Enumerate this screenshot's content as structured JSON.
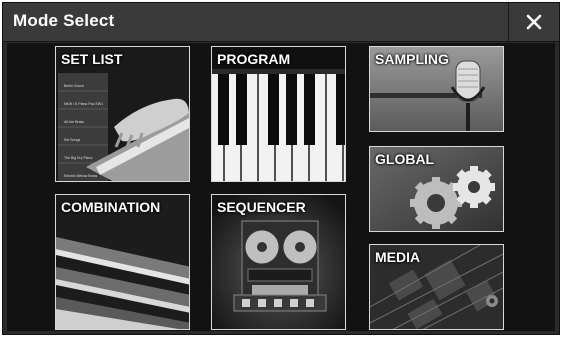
{
  "header": {
    "title": "Mode Select",
    "close_icon": "close-icon"
  },
  "tiles": {
    "set_list": {
      "label": "SET LIST",
      "slots": [
        "Berlin Grand",
        "NKW / E.Piano Pad SW1",
        "All Are Brass",
        "Set Songs",
        "The Big Dry Piano",
        "Electric Mellow Brass"
      ]
    },
    "program": {
      "label": "PROGRAM"
    },
    "sampling": {
      "label": "SAMPLING"
    },
    "global": {
      "label": "GLOBAL"
    },
    "combination": {
      "label": "COMBINATION"
    },
    "sequencer": {
      "label": "SEQUENCER"
    },
    "media": {
      "label": "MEDIA"
    }
  },
  "colors": {
    "header_bg": "#3a3a3a",
    "content_bg": "#121212",
    "tile_border": "#d8d8d8",
    "text": "#ffffff"
  }
}
